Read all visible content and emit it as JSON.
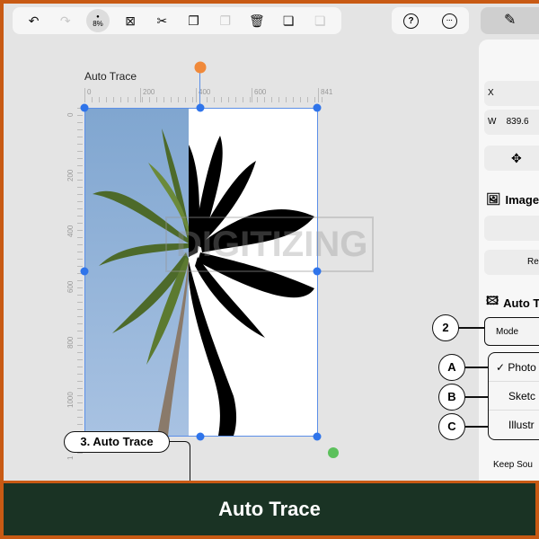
{
  "toolbar": {
    "zoom": "8%",
    "items": [
      "undo",
      "redo",
      "zoom",
      "deselect",
      "cut",
      "copy",
      "paste-disabled",
      "delete",
      "duplicate",
      "duplicate-disabled"
    ]
  },
  "top_right": {
    "help": "?",
    "more": "···"
  },
  "canvas": {
    "title": "Auto Trace",
    "ruler_x": [
      "0",
      "200",
      "400",
      "600",
      "841"
    ],
    "ruler_y": [
      "0",
      "200",
      "400",
      "600",
      "800",
      "1000",
      "1"
    ],
    "watermark": "DIGITIZING"
  },
  "panel": {
    "x_label": "X",
    "w_label": "W",
    "w_value": "839.6",
    "image_section": "Image",
    "re_button": "Re",
    "auto_trace_section": "Auto T",
    "mode_label": "Mode",
    "keep_source": "Keep Sou"
  },
  "mode_menu": {
    "items": [
      {
        "label": "Photo",
        "checked": true
      },
      {
        "label": "Sketc",
        "checked": false
      },
      {
        "label": "Illustr",
        "checked": false
      }
    ]
  },
  "callouts": {
    "step3": "3. Auto Trace",
    "two": "2",
    "a": "A",
    "b": "B",
    "c": "C"
  },
  "banner": {
    "title": "Auto Trace"
  },
  "colors": {
    "border": "#c85a14",
    "banner": "#1a3324",
    "selection": "#2f74ea",
    "rotate_handle": "#f0893a",
    "green_handle": "#5cc05c"
  }
}
